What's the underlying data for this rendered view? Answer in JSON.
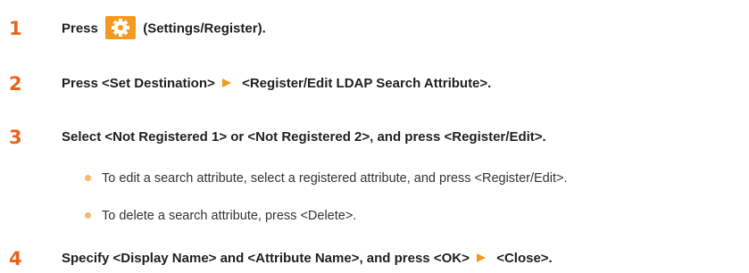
{
  "colors": {
    "step_number": "#e8641b",
    "arrow": "#f39a1e",
    "bullet": "#f7b66a",
    "gear_icon_bg": "#f39a1e"
  },
  "steps": [
    {
      "number": "1",
      "before_icon": "Press",
      "icon": "gear-icon",
      "after_icon": "(Settings/Register)."
    },
    {
      "number": "2",
      "part1": "Press <Set Destination>",
      "icon": "arrow-icon",
      "part2": "<Register/Edit LDAP Search Attribute>."
    },
    {
      "number": "3",
      "text": "Select <Not Registered 1> or <Not Registered 2>, and press <Register/Edit>.",
      "bullets": [
        "To edit a search attribute, select a registered attribute, and press <Register/Edit>.",
        "To delete a search attribute, press <Delete>."
      ]
    },
    {
      "number": "4",
      "part1": "Specify <Display Name> and <Attribute Name>, and press <OK>",
      "icon": "arrow-icon",
      "part2": "<Close>."
    }
  ]
}
